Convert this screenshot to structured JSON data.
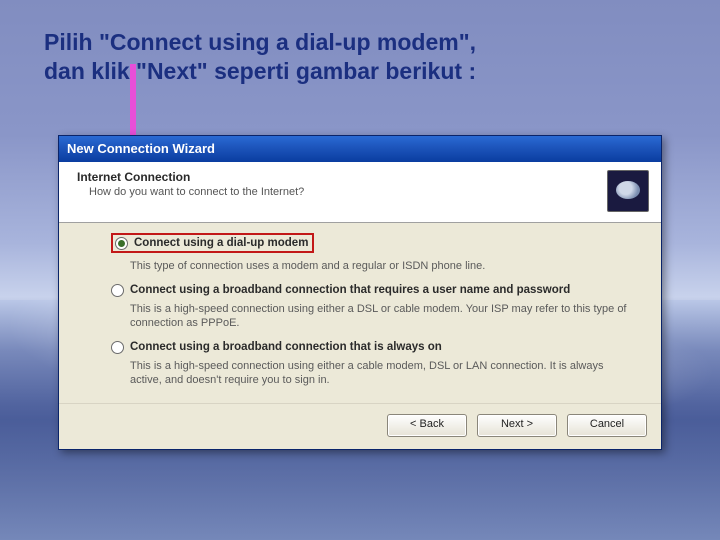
{
  "instruction": {
    "line1": "Pilih \"Connect using a dial-up modem\",",
    "line2": "dan klik \"Next\" seperti gambar berikut :"
  },
  "window": {
    "title": "New Connection Wizard",
    "header": {
      "title": "Internet Connection",
      "subtitle": "How do you want to connect to the Internet?"
    },
    "options": [
      {
        "label": "Connect using a dial-up modem",
        "description": "This type of connection uses a modem and a regular or ISDN phone line.",
        "checked": true,
        "highlighted": true
      },
      {
        "label": "Connect using a broadband connection that requires a user name and password",
        "description": "This is a high-speed connection using either a DSL or cable modem. Your ISP may refer to this type of connection as PPPoE.",
        "checked": false,
        "highlighted": false
      },
      {
        "label": "Connect using a broadband connection that is always on",
        "description": "This is a high-speed connection using either a cable modem, DSL or LAN connection. It is always active, and doesn't require you to sign in.",
        "checked": false,
        "highlighted": false
      }
    ],
    "buttons": {
      "back": "< Back",
      "next": "Next >",
      "cancel": "Cancel"
    }
  }
}
